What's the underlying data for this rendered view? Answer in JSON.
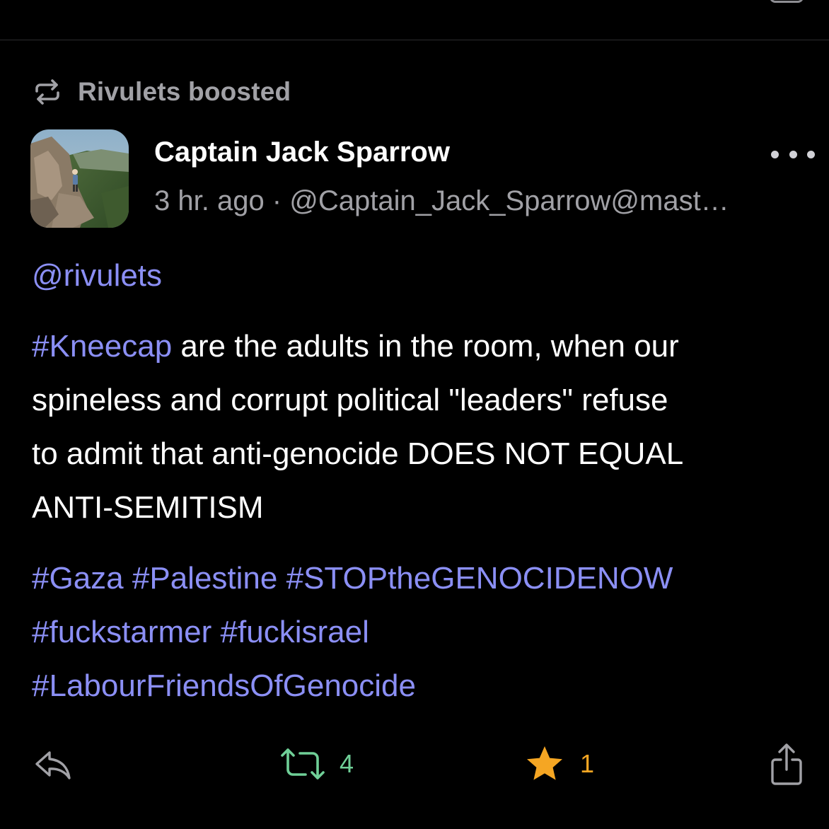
{
  "boost_banner": {
    "label": "Rivulets boosted",
    "icon": "boost-arrows-icon"
  },
  "post": {
    "author": {
      "display_name": "Captain Jack Sparrow",
      "avatar": "mountain-climber-photo"
    },
    "meta": "3 hr. ago · @Captain_Jack_Sparrow@mast…",
    "mention": "@rivulets",
    "content": {
      "hashtag_kneecap": "#Kneecap",
      "text_lines": [
        " are the adults in the room, when our",
        "spineless and corrupt political \"leaders\" refuse",
        "to admit that anti-genocide DOES NOT EQUAL",
        "ANTI-SEMITISM"
      ]
    },
    "tags": [
      "#Gaza",
      "#Palestine",
      "#STOPtheGENOCIDENOW",
      "#fuckstarmer",
      "#fuckisrael",
      "#LabourFriendsOfGenocide"
    ]
  },
  "actions": {
    "reply": {
      "icon": "reply-icon"
    },
    "boost": {
      "icon": "boost-icon",
      "count": "4"
    },
    "favourite": {
      "icon": "star-icon",
      "count": "1"
    },
    "share": {
      "icon": "share-icon"
    }
  },
  "colors": {
    "background": "#000000",
    "link": "#8b8ff5",
    "boost_green": "#6fcf97",
    "star_orange": "#f5a623",
    "secondary_text": "#a1a1a6"
  }
}
